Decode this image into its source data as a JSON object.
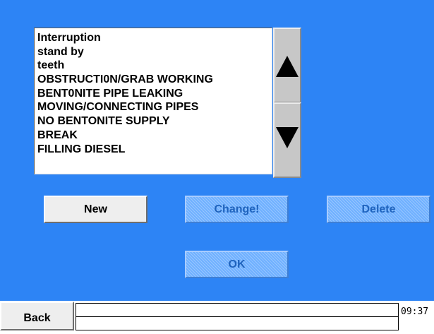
{
  "list": {
    "items": [
      "Interruption",
      "stand by",
      "teeth",
      "OBSTRUCTI0N/GRAB WORKING",
      "BENT0NITE PIPE LEAKING",
      "MOVING/CONNECTING PIPES",
      "NO BENTONITE SUPPLY",
      "BREAK",
      "FILLING DIESEL"
    ]
  },
  "scroll": {
    "up_icon": "triangle-up-icon",
    "down_icon": "triangle-down-icon"
  },
  "buttons": {
    "new_label": "New",
    "change_label": "Change!",
    "delete_label": "Delete",
    "ok_label": "OK"
  },
  "status_bar": {
    "back_label": "Back",
    "message": "",
    "time": "09:37"
  },
  "colors": {
    "background": "#2d84f5",
    "disabled_button": "#6fb0ff",
    "enabled_button": "#eeeeee"
  }
}
